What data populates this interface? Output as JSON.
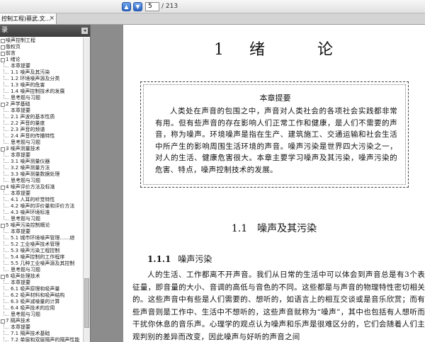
{
  "toolbar": {
    "prev_icon": "arrow-up-icon",
    "next_icon": "arrow-down-icon",
    "page_current": "5",
    "page_total": "/ 213",
    "accent": "#2c64c4"
  },
  "tab": {
    "label": "控制工程)蔡武.文...",
    "close": "×"
  },
  "sidebar": {
    "title": "录",
    "collapse": "◂",
    "items": [
      {
        "text": "噪声控制工程",
        "level": 0
      },
      {
        "text": "版权页",
        "level": 0
      },
      {
        "text": "前言",
        "level": 0
      },
      {
        "text": "1  绪论",
        "level": 0
      },
      {
        "text": "本章提要",
        "level": 1
      },
      {
        "text": "1.1  噪声及其污染",
        "level": 1
      },
      {
        "text": "1.2  环境噪声源及分类",
        "level": 1
      },
      {
        "text": "1.3  噪声的危害",
        "level": 1
      },
      {
        "text": "1.4  噪声控制技术的发展",
        "level": 1
      },
      {
        "text": "思考题与习题",
        "level": 1
      },
      {
        "text": "2  声学基础",
        "level": 0
      },
      {
        "text": "本章提要",
        "level": 1
      },
      {
        "text": "2.1  声波的基本性质",
        "level": 1
      },
      {
        "text": "2.2  声音的量度",
        "level": 1
      },
      {
        "text": "2.3  声音的频谱",
        "level": 1
      },
      {
        "text": "2.4  声音的传播特性",
        "level": 1
      },
      {
        "text": "思考题与习题",
        "level": 1
      },
      {
        "text": "3  噪声测量技术",
        "level": 0
      },
      {
        "text": "本章提要",
        "level": 1
      },
      {
        "text": "3.1  噪声测量仪器",
        "level": 1
      },
      {
        "text": "3.2  噪声测量方法",
        "level": 1
      },
      {
        "text": "3.3  噪声测量数据处理",
        "level": 1
      },
      {
        "text": "思考题与习题",
        "level": 1
      },
      {
        "text": "4  噪声评价方法及标准",
        "level": 0
      },
      {
        "text": "本章提要",
        "level": 1
      },
      {
        "text": "4.1  人耳的听觉特性",
        "level": 1
      },
      {
        "text": "4.2  噪声的评价量和评价方法",
        "level": 1
      },
      {
        "text": "4.3  噪声环境标准",
        "level": 1
      },
      {
        "text": "思考题与习题",
        "level": 1
      },
      {
        "text": "5  噪声污染控制概论",
        "level": 0
      },
      {
        "text": "本章提要",
        "level": 1
      },
      {
        "text": "5.1  城市环境噪声管理……综",
        "level": 1
      },
      {
        "text": "5.2  工业噪声技术管理",
        "level": 1
      },
      {
        "text": "5.3  噪声污染工程控制",
        "level": 1
      },
      {
        "text": "5.4  噪声控制的工作程序",
        "level": 1
      },
      {
        "text": "5.5  几种工业噪声源及其控制",
        "level": 1
      },
      {
        "text": "思考题与习题",
        "level": 1
      },
      {
        "text": "6  吸声处理技术",
        "level": 0
      },
      {
        "text": "本章提要",
        "level": 1
      },
      {
        "text": "6.1  吸声原理和吸声量",
        "level": 1
      },
      {
        "text": "6.2  吸声材料和吸声结构",
        "level": 1
      },
      {
        "text": "6.3  吸声减噪量的计算",
        "level": 1
      },
      {
        "text": "6.4  吸声技术的应用",
        "level": 1
      },
      {
        "text": "思考题与习题",
        "level": 1
      },
      {
        "text": "7  隔声技术",
        "level": 0
      },
      {
        "text": "本章提要",
        "level": 1
      },
      {
        "text": "7.1  隔声技术基础",
        "level": 1
      },
      {
        "text": "7.2  单层和双层隔声的隔声性能",
        "level": 1
      },
      {
        "text": "7.3  常见隔声构件的隔声性能",
        "level": 1
      }
    ]
  },
  "document": {
    "chapter_num": "1",
    "chapter_title_1": "绪",
    "chapter_title_2": "论",
    "abstract_title": "本章提要",
    "abstract_text": "人类处在声音的包围之中，声音对人类社会的各项社会实践都非常有用。但有些声音的存在影响人们正常工作和健康，是人们不需要的声音，称为噪声。环境噪声是指在生产、建筑施工、交通运输和社会生活中所产生的影响周围生活环境的声音。噪声污染是世界四大污染之一，对人的生活、健康危害很大。本章主要学习噪声及其污染，噪声污染的危害、特点，噪声控制技术的发展。",
    "section_num": "1.1",
    "section_title": "噪声及其污染",
    "subsection_num": "1.1.1",
    "subsection_title": "噪声污染",
    "body_text": "人的生活、工作都离不开声音。我们从日常的生活中可以体会到声音总是有3个表征量，即音量的大小、音调的高低与音色的不同。这些都是与声音的物理特性密切相关的。这些声音中有些是人们需要的、想听的，如语言上的相互交谈或是音乐欣赏；而有些声音则是工作中、生活中不想听的，这些声音就称为“噪声”，其中也包括有人想听而干扰你休息的音乐声。心理学的观点认为噪声和乐声是很难区分的，它们会随着人们主观判别的差异而改变，因此噪声与好听的声音之间"
  }
}
